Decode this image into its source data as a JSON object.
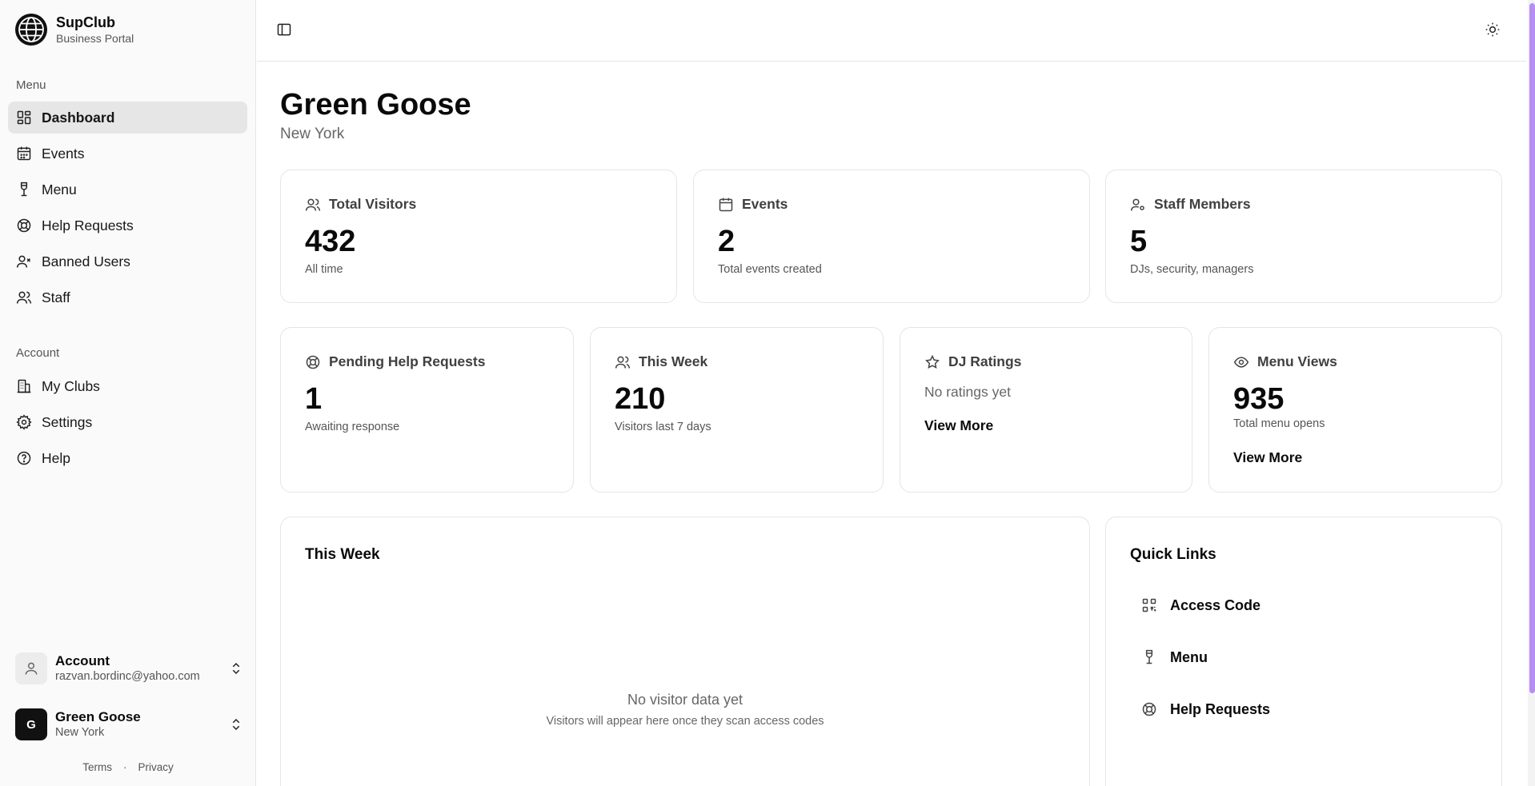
{
  "brand": {
    "name": "SupClub",
    "subtitle": "Business Portal"
  },
  "sidebar": {
    "menu_label": "Menu",
    "menu_items": [
      {
        "label": "Dashboard",
        "icon": "dashboard-icon",
        "active": true
      },
      {
        "label": "Events",
        "icon": "calendar-icon"
      },
      {
        "label": "Menu",
        "icon": "wine-glass-icon"
      },
      {
        "label": "Help Requests",
        "icon": "lifebuoy-icon"
      },
      {
        "label": "Banned Users",
        "icon": "user-x-icon"
      },
      {
        "label": "Staff",
        "icon": "users-icon"
      }
    ],
    "account_label": "Account",
    "account_items": [
      {
        "label": "My Clubs",
        "icon": "building-icon"
      },
      {
        "label": "Settings",
        "icon": "gear-icon"
      },
      {
        "label": "Help",
        "icon": "help-circle-icon"
      }
    ],
    "account_switcher": {
      "title": "Account",
      "subtitle": "razvan.bordinc@yahoo.com"
    },
    "club_switcher": {
      "avatar": "G",
      "title": "Green Goose",
      "subtitle": "New York"
    },
    "footer": {
      "terms": "Terms",
      "separator": "·",
      "privacy": "Privacy"
    }
  },
  "page": {
    "title": "Green Goose",
    "subtitle": "New York"
  },
  "stats_row1": [
    {
      "label": "Total Visitors",
      "value": "432",
      "desc": "All time",
      "icon": "users-icon"
    },
    {
      "label": "Events",
      "value": "2",
      "desc": "Total events created",
      "icon": "calendar-icon"
    },
    {
      "label": "Staff Members",
      "value": "5",
      "desc": "DJs, security, managers",
      "icon": "user-cog-icon"
    }
  ],
  "stats_row2": [
    {
      "label": "Pending Help Requests",
      "value": "1",
      "desc": "Awaiting response",
      "icon": "lifebuoy-icon"
    },
    {
      "label": "This Week",
      "value": "210",
      "desc": "Visitors last 7 days",
      "icon": "users-icon"
    },
    {
      "label": "DJ Ratings",
      "note": "No ratings yet",
      "link": "View More",
      "icon": "star-icon"
    },
    {
      "label": "Menu Views",
      "value": "935",
      "desc": "Total menu opens",
      "link": "View More",
      "icon": "eye-icon"
    }
  ],
  "this_week_panel": {
    "title": "This Week",
    "empty_title": "No visitor data yet",
    "empty_sub": "Visitors will appear here once they scan access codes"
  },
  "quick_links": {
    "title": "Quick Links",
    "items": [
      {
        "label": "Access Code",
        "icon": "qr-code-icon"
      },
      {
        "label": "Menu",
        "icon": "wine-glass-icon"
      },
      {
        "label": "Help Requests",
        "icon": "lifebuoy-icon"
      }
    ]
  },
  "colors": {
    "accent_scroll": "#b48ef0",
    "active_nav_bg": "#e6e6e6"
  }
}
